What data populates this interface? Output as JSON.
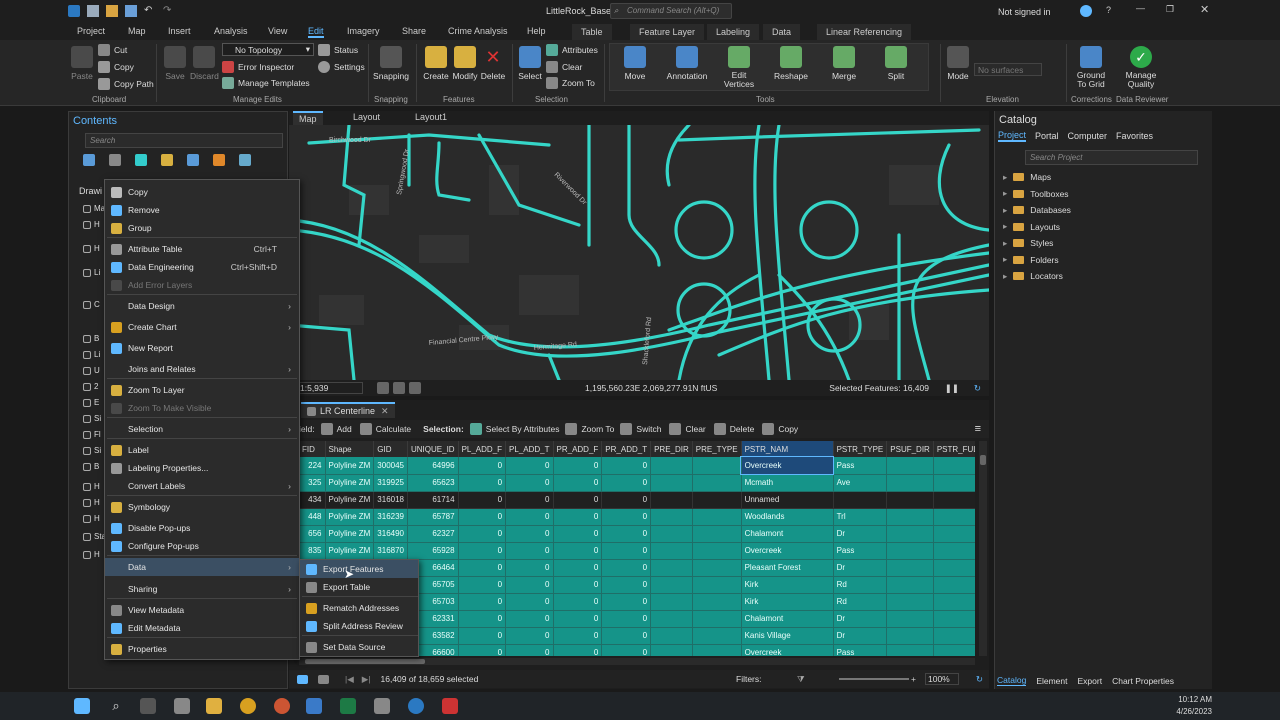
{
  "titlebar": {
    "project": "LittleRock_Base",
    "search_placeholder": "Command Search (Alt+Q)",
    "signin": "Not signed in"
  },
  "tabs": [
    "Project",
    "Map",
    "Insert",
    "Analysis",
    "View",
    "Edit",
    "Imagery",
    "Share",
    "Crime Analysis",
    "Help"
  ],
  "context_tabs": [
    "Table",
    "Feature Layer",
    "Labeling",
    "Data",
    "Linear Referencing"
  ],
  "ribbon": {
    "clipboard": {
      "paste": "Paste",
      "cut": "Cut",
      "copy": "Copy",
      "copy_path": "Copy Path",
      "label": "Clipboard"
    },
    "manage_edits": {
      "save": "Save",
      "discard": "Discard",
      "topology": "No Topology",
      "error_inspector": "Error Inspector",
      "manage_templates": "Manage Templates",
      "status": "Status",
      "settings": "Settings",
      "label": "Manage Edits"
    },
    "snapping": {
      "btn": "Snapping",
      "label": "Snapping"
    },
    "features": {
      "create": "Create",
      "modify": "Modify",
      "delete": "Delete",
      "label": "Features"
    },
    "selection": {
      "select": "Select",
      "attributes": "Attributes",
      "clear": "Clear",
      "zoom_to": "Zoom To",
      "label": "Selection"
    },
    "tools": {
      "move": "Move",
      "annotation": "Annotation",
      "edit_vertices_1": "Edit",
      "edit_vertices_2": "Vertices",
      "reshape": "Reshape",
      "merge": "Merge",
      "split": "Split",
      "label": "Tools"
    },
    "elevation": {
      "mode": "Mode",
      "surface": "No surfaces",
      "label": "Elevation"
    },
    "corrections": {
      "ground1": "Ground",
      "ground2": "To Grid",
      "label": "Corrections"
    },
    "reviewer": {
      "mq1": "Manage",
      "mq2": "Quality",
      "label": "Data Reviewer"
    }
  },
  "contents": {
    "title": "Contents",
    "search": "Search",
    "drawing_order": "Drawi",
    "side_letters": [
      "Ma",
      "H",
      "H",
      "Li",
      "C",
      "B",
      "Li",
      "U",
      "2",
      "E",
      "Si",
      "Fl",
      "Si",
      "B",
      "H",
      "H",
      "H",
      "Stanc",
      "H"
    ]
  },
  "map": {
    "tabs": [
      "Map",
      "Layout",
      "Layout1"
    ],
    "scale": "1:5,939",
    "coords": "1,195,560.23E 2,069,277.91N ftUS",
    "selected": "Selected Features: 16,409",
    "street_labels": [
      "Birchwood Dr",
      "Springwood Dr",
      "Riverwood Dr",
      "Financial Centre Pkwy",
      "Hermitage Rd",
      "Shackleford Rd"
    ]
  },
  "table": {
    "tab": "LR Centerline",
    "toolbar": {
      "field": "ield:",
      "add": "Add",
      "calculate": "Calculate",
      "selection": "Selection:",
      "select_by_attr": "Select By Attributes",
      "zoom_to": "Zoom To",
      "switch": "Switch",
      "clear": "Clear",
      "delete": "Delete",
      "copy": "Copy"
    },
    "columns": [
      "FID",
      "Shape",
      "GID",
      "UNIQUE_ID",
      "PL_ADD_F",
      "PL_ADD_T",
      "PR_ADD_F",
      "PR_ADD_T",
      "PRE_DIR",
      "PRE_TYPE",
      "PSTR_NAM",
      "PSTR_TYPE",
      "PSUF_DIR",
      "PSTR_FULNA"
    ],
    "rows": [
      {
        "fid": "224",
        "shape": "Polyline ZM",
        "gid": "300045",
        "uid": "64996",
        "a": "0",
        "b": "0",
        "c": "0",
        "d": "0",
        "name": "Overcreek",
        "type": "Pass",
        "sel": true
      },
      {
        "fid": "325",
        "shape": "Polyline ZM",
        "gid": "319925",
        "uid": "65623",
        "a": "0",
        "b": "0",
        "c": "0",
        "d": "0",
        "name": "Mcmath",
        "type": "Ave",
        "sel": true
      },
      {
        "fid": "434",
        "shape": "Polyline ZM",
        "gid": "316018",
        "uid": "61714",
        "a": "0",
        "b": "0",
        "c": "0",
        "d": "0",
        "name": "Unnamed",
        "type": "",
        "sel": false
      },
      {
        "fid": "448",
        "shape": "Polyline ZM",
        "gid": "316239",
        "uid": "65787",
        "a": "0",
        "b": "0",
        "c": "0",
        "d": "0",
        "name": "Woodlands",
        "type": "Trl",
        "sel": true
      },
      {
        "fid": "656",
        "shape": "Polyline ZM",
        "gid": "316490",
        "uid": "62327",
        "a": "0",
        "b": "0",
        "c": "0",
        "d": "0",
        "name": "Chalamont",
        "type": "Dr",
        "sel": true
      },
      {
        "fid": "835",
        "shape": "Polyline ZM",
        "gid": "316870",
        "uid": "65928",
        "a": "0",
        "b": "0",
        "c": "0",
        "d": "0",
        "name": "Overcreek",
        "type": "Pass",
        "sel": true
      },
      {
        "fid": "",
        "shape": "",
        "gid": "",
        "uid": "66464",
        "a": "0",
        "b": "0",
        "c": "0",
        "d": "0",
        "name": "Pleasant Forest",
        "type": "Dr",
        "sel": true
      },
      {
        "fid": "",
        "shape": "",
        "gid": "",
        "uid": "65705",
        "a": "0",
        "b": "0",
        "c": "0",
        "d": "0",
        "name": "Kirk",
        "type": "Rd",
        "sel": true
      },
      {
        "fid": "",
        "shape": "",
        "gid": "",
        "uid": "65703",
        "a": "0",
        "b": "0",
        "c": "0",
        "d": "0",
        "name": "Kirk",
        "type": "Rd",
        "sel": true
      },
      {
        "fid": "",
        "shape": "",
        "gid": "",
        "uid": "62331",
        "a": "0",
        "b": "0",
        "c": "0",
        "d": "0",
        "name": "Chalamont",
        "type": "Dr",
        "sel": true
      },
      {
        "fid": "",
        "shape": "",
        "gid": "",
        "uid": "63582",
        "a": "0",
        "b": "0",
        "c": "0",
        "d": "0",
        "name": "Kanis Village",
        "type": "Dr",
        "sel": true
      },
      {
        "fid": "",
        "shape": "",
        "gid": "",
        "uid": "66600",
        "a": "0",
        "b": "0",
        "c": "0",
        "d": "0",
        "name": "Overcreek",
        "type": "Pass",
        "sel": true
      }
    ],
    "footer": {
      "count": "16,409 of 18,659 selected",
      "filters": "Filters:",
      "zoom": "100%"
    }
  },
  "context_menu": {
    "items": [
      {
        "label": "Copy",
        "icon": "copy-icon"
      },
      {
        "label": "Remove",
        "icon": "remove-icon"
      },
      {
        "label": "Group",
        "icon": "group-icon"
      },
      {
        "label": "Attribute Table",
        "shortcut": "Ctrl+T",
        "icon": "table-icon"
      },
      {
        "label": "Data Engineering",
        "shortcut": "Ctrl+Shift+D",
        "icon": "data-engineering-icon"
      },
      {
        "label": "Add Error Layers",
        "disabled": true,
        "icon": "error-layers-icon"
      },
      {
        "label": "Data Design",
        "sub": true
      },
      {
        "label": "Create Chart",
        "sub": true,
        "icon": "chart-icon"
      },
      {
        "label": "New Report",
        "icon": "report-icon"
      },
      {
        "label": "Joins and Relates",
        "sub": true
      },
      {
        "label": "Zoom To Layer",
        "icon": "zoom-layer-icon"
      },
      {
        "label": "Zoom To Make Visible",
        "disabled": true,
        "icon": "zoom-visible-icon"
      },
      {
        "label": "Selection",
        "sub": true
      },
      {
        "label": "Label",
        "icon": "label-icon"
      },
      {
        "label": "Labeling Properties...",
        "icon": "labeling-icon"
      },
      {
        "label": "Convert Labels",
        "sub": true
      },
      {
        "label": "Symbology",
        "icon": "symbology-icon"
      },
      {
        "label": "Disable Pop-ups",
        "icon": "popup-icon"
      },
      {
        "label": "Configure Pop-ups",
        "icon": "configure-popup-icon"
      },
      {
        "label": "Data",
        "sub": true,
        "active": true
      },
      {
        "label": "Sharing",
        "sub": true
      },
      {
        "label": "View Metadata",
        "icon": "metadata-icon"
      },
      {
        "label": "Edit Metadata",
        "icon": "edit-metadata-icon"
      },
      {
        "label": "Properties",
        "icon": "properties-icon"
      }
    ],
    "submenu": [
      {
        "label": "Export Features",
        "icon": "export-features-icon"
      },
      {
        "label": "Export Table",
        "icon": "export-table-icon"
      },
      {
        "label": "Rematch Addresses",
        "icon": "rematch-icon"
      },
      {
        "label": "Split Address Review",
        "icon": "split-review-icon"
      },
      {
        "label": "Set Data Source",
        "icon": "data-source-icon"
      }
    ]
  },
  "catalog": {
    "title": "Catalog",
    "tabs": [
      "Project",
      "Portal",
      "Computer",
      "Favorites"
    ],
    "search": "Search Project",
    "items": [
      "Maps",
      "Toolboxes",
      "Databases",
      "Layouts",
      "Styles",
      "Folders",
      "Locators"
    ],
    "bottom_tabs": [
      "Catalog",
      "Element",
      "Export",
      "Chart Properties"
    ]
  },
  "taskbar": {
    "time": "10:12 AM",
    "date": "4/26/2023"
  }
}
